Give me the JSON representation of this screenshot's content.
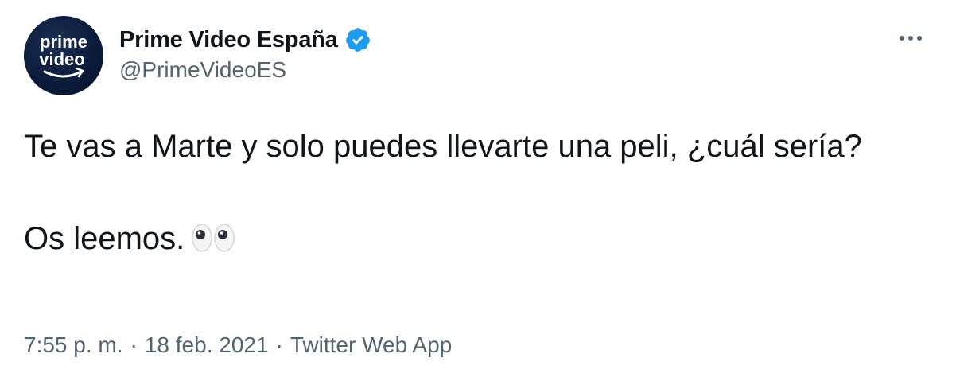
{
  "author": {
    "display_name": "Prime Video España",
    "handle": "@PrimeVideoES",
    "verified": true,
    "avatar_text_line1": "prime",
    "avatar_text_line2": "video"
  },
  "tweet": {
    "line1": "Te vas a Marte y solo puedes llevarte una peli, ¿cuál sería?",
    "line2": "Os leemos.",
    "emoji": "eyes-emoji"
  },
  "meta": {
    "time": "7:55 p. m.",
    "date": "18 feb. 2021",
    "source": "Twitter Web App",
    "separator": "·"
  },
  "colors": {
    "verified_blue": "#1d9bf0",
    "secondary_text": "#536471",
    "primary_text": "#0f1419",
    "avatar_bg": "#0b1a38"
  },
  "icons": {
    "more": "more-options-icon",
    "verified": "verified-badge-icon"
  }
}
